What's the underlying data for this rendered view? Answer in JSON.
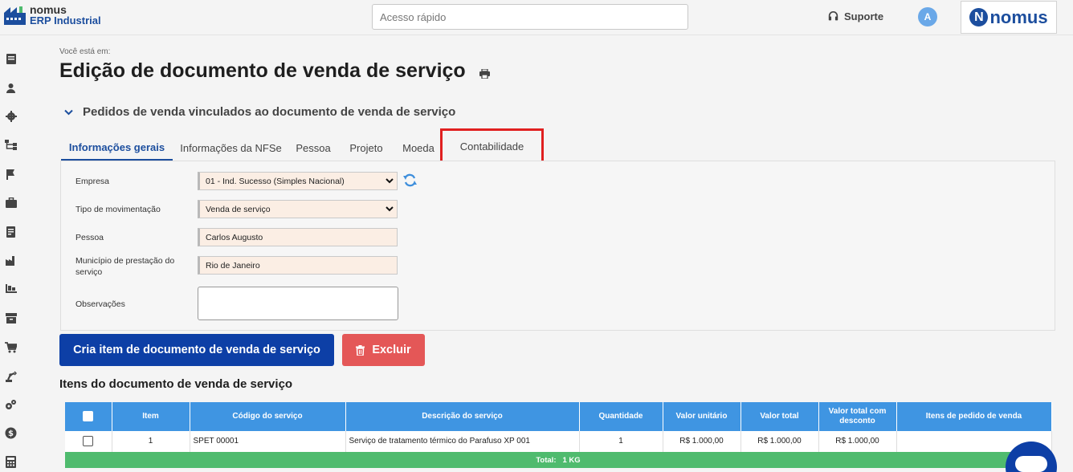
{
  "topbar": {
    "logo_line1": "nomus",
    "logo_line2": "ERP Industrial",
    "quick_access_placeholder": "Acesso rápido",
    "support_label": "Suporte",
    "avatar_initial": "A",
    "brand_letter": "N",
    "brand_name": "nomus"
  },
  "rail": {
    "icons": [
      "book-icon",
      "user-icon",
      "gear-icon",
      "hierarchy-icon",
      "flag-icon",
      "briefcase-icon",
      "invoice-icon",
      "factory-icon",
      "pallet-icon",
      "archive-icon",
      "cart-icon",
      "robot-arm-icon",
      "gears-icon",
      "dollar-icon",
      "calculator-icon"
    ]
  },
  "page": {
    "breadcrumb": "Você está em:",
    "title": "Edição de documento de venda de serviço",
    "section_title": "Pedidos de venda vinculados ao documento de venda de serviço"
  },
  "tabs": [
    {
      "label": "Informações gerais",
      "active": true
    },
    {
      "label": "Informações da NFSe",
      "active": false
    },
    {
      "label": "Pessoa",
      "active": false
    },
    {
      "label": "Projeto",
      "active": false
    },
    {
      "label": "Moeda",
      "active": false
    },
    {
      "label": "Contabilidade",
      "active": false,
      "highlighted": true
    }
  ],
  "form": {
    "empresa_label": "Empresa",
    "empresa_value": "01 - Ind. Sucesso (Simples Nacional)",
    "tipo_label": "Tipo de movimentação",
    "tipo_value": "Venda de serviço",
    "pessoa_label": "Pessoa",
    "pessoa_value": "Carlos Augusto",
    "municipio_label": "Município de prestação do serviço",
    "municipio_value": "Rio de Janeiro",
    "observacoes_label": "Observações",
    "observacoes_value": ""
  },
  "actions": {
    "create_label": "Cria item de documento de venda de serviço",
    "delete_label": "Excluir"
  },
  "items": {
    "title": "Itens do documento de venda de serviço",
    "headers": [
      "Item",
      "Código do serviço",
      "Descrição do serviço",
      "Quantidade",
      "Valor unitário",
      "Valor total",
      "Valor total com desconto",
      "Itens de pedido de venda"
    ],
    "rows": [
      {
        "item": "1",
        "codigo": "SPET 00001",
        "descricao": "Serviço de tratamento térmico do Parafuso XP 001",
        "quantidade": "1",
        "valor_unitario": "R$ 1.000,00",
        "valor_total": "R$ 1.000,00",
        "valor_desconto": "R$ 1.000,00",
        "itens_pedido": ""
      }
    ],
    "total_label": "Total:",
    "total_value": "1 KG"
  },
  "colors": {
    "primary": "#0d3fa6",
    "danger": "#e45757",
    "table_header": "#3f95e2",
    "total_bar": "#4fbb6e",
    "highlight": "#e02020"
  }
}
